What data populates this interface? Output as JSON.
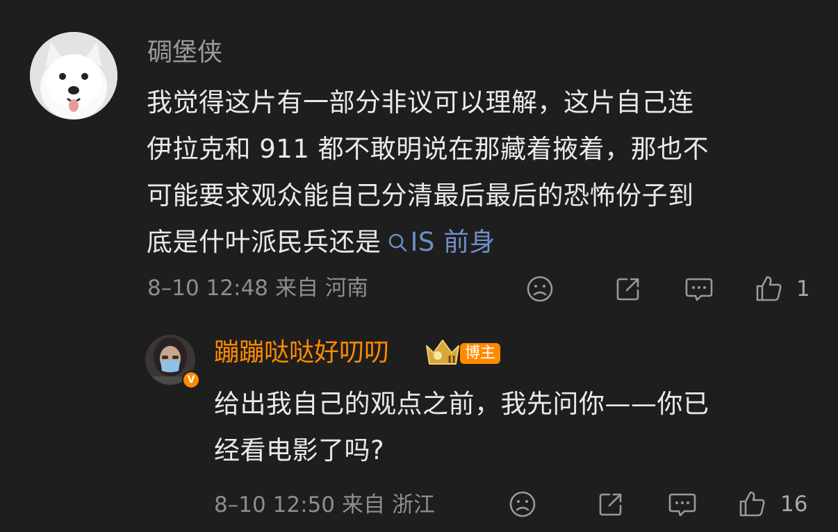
{
  "comment1": {
    "username": "碉堡侠",
    "text_lines": [
      "我觉得这片有一部分非议可以理解，这片自己连",
      "伊拉克和 911 都不敢明说在那藏着掖着，那也不",
      "可能要求观众能自己分清最后最后的恐怖份子到"
    ],
    "last_line_prefix": "底是什叶派民兵还是",
    "topic_link": "IS 前身",
    "date": "8–10",
    "time": "12:48",
    "from_label": "来自",
    "location": "河南",
    "like_count": "1"
  },
  "comment2": {
    "username": "蹦蹦哒哒好叨叨",
    "badge": "博主",
    "crown_level": "II",
    "verified_mark": "V",
    "text_lines": [
      "给出我自己的观点之前，我先问你——你已",
      "经看电影了吗?"
    ],
    "date": "8–10",
    "time": "12:50",
    "from_label": "来自",
    "location": "浙江",
    "like_count": "16"
  },
  "colors": {
    "background": "#1e1e1e",
    "username1": "#9c9c9c",
    "username2": "#ff8a00",
    "link": "#6d8fc8",
    "meta": "#8e8e8e"
  },
  "icons": [
    "search-icon",
    "frown-icon",
    "share-icon",
    "comment-icon",
    "thumbs-up-icon",
    "crown-icon",
    "verified-icon"
  ]
}
